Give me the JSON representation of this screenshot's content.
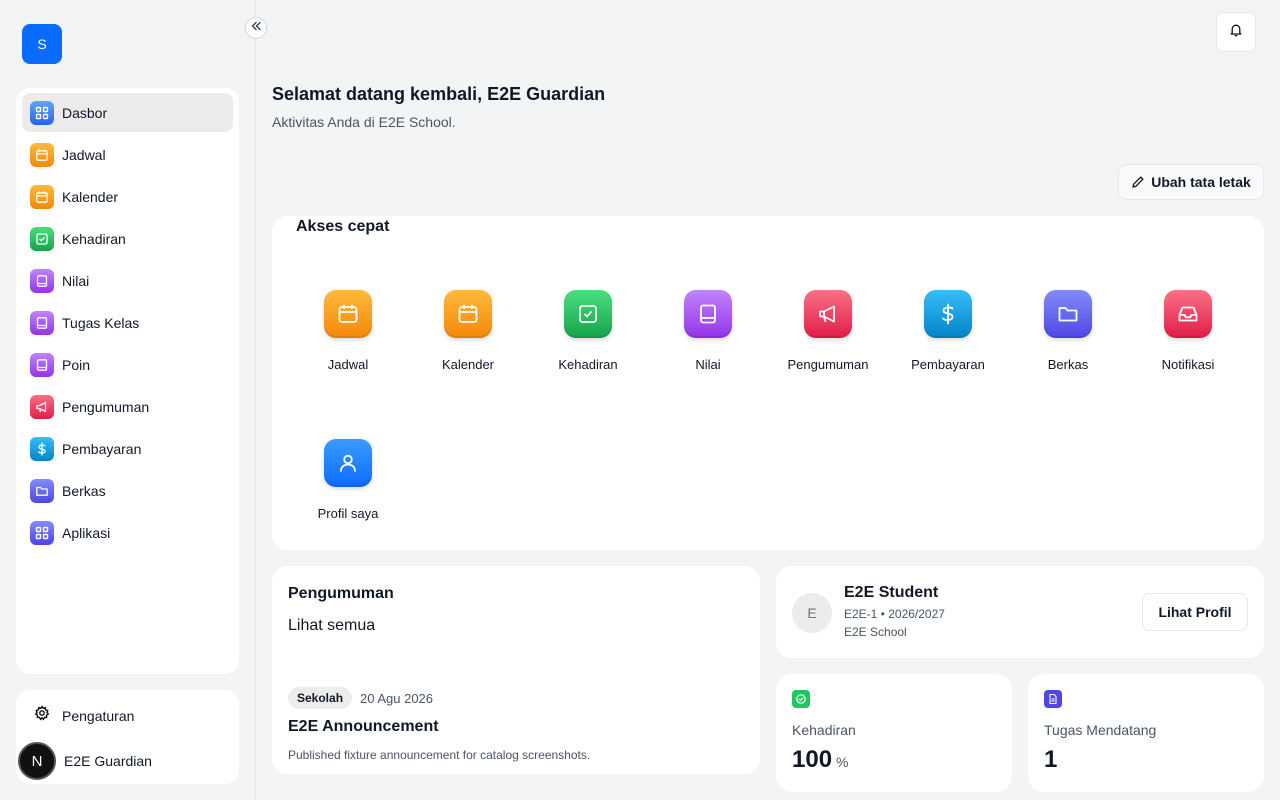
{
  "brand": {
    "logo_letter": "S",
    "accent": "#0a6cff"
  },
  "sidebar": {
    "items": [
      {
        "label": "Dasbor",
        "icon": "grid-icon",
        "active": true
      },
      {
        "label": "Jadwal",
        "icon": "calendar-icon"
      },
      {
        "label": "Kalender",
        "icon": "calendar-icon"
      },
      {
        "label": "Kehadiran",
        "icon": "check-square-icon"
      },
      {
        "label": "Nilai",
        "icon": "book-icon"
      },
      {
        "label": "Tugas Kelas",
        "icon": "book-icon"
      },
      {
        "label": "Poin",
        "icon": "book-icon"
      },
      {
        "label": "Pengumuman",
        "icon": "megaphone-icon"
      },
      {
        "label": "Pembayaran",
        "icon": "dollar-icon"
      },
      {
        "label": "Berkas",
        "icon": "folder-icon"
      },
      {
        "label": "Aplikasi",
        "icon": "grid-icon"
      }
    ],
    "settings_label": "Pengaturan",
    "user_label": "E2E Guardian",
    "user_avatar_letter": "N"
  },
  "header": {
    "title": "Selamat datang kembali, E2E Guardian",
    "subtitle": "Aktivitas Anda di E2E School.",
    "layout_button": "Ubah tata letak"
  },
  "quick_access": {
    "title": "Akses cepat",
    "tiles": [
      {
        "label": "Jadwal",
        "icon": "calendar-icon"
      },
      {
        "label": "Kalender",
        "icon": "calendar-icon"
      },
      {
        "label": "Kehadiran",
        "icon": "check-square-icon"
      },
      {
        "label": "Nilai",
        "icon": "book-icon"
      },
      {
        "label": "Pengumuman",
        "icon": "megaphone-icon"
      },
      {
        "label": "Pembayaran",
        "icon": "dollar-icon"
      },
      {
        "label": "Berkas",
        "icon": "folder-icon"
      },
      {
        "label": "Notifikasi",
        "icon": "inbox-icon"
      },
      {
        "label": "Profil saya",
        "icon": "user-icon"
      }
    ]
  },
  "announcements": {
    "title": "Pengumuman",
    "see_all": "Lihat semua",
    "item": {
      "badge": "Sekolah",
      "date": "20 Agu 2026",
      "title": "E2E Announcement",
      "body": "Published fixture announcement for catalog screenshots."
    }
  },
  "profile": {
    "avatar_letter": "E",
    "name": "E2E Student",
    "class_year": "E2E-1 • 2026/2027",
    "school": "E2E School",
    "button": "Lihat Profil"
  },
  "stats": [
    {
      "label": "Kehadiran",
      "value": "100",
      "unit": "%",
      "icon": "check-circle-icon",
      "color": "#22c55e"
    },
    {
      "label": "Tugas Mendatang",
      "value": "1",
      "unit": "",
      "icon": "document-icon",
      "color": "#4f46e5"
    }
  ]
}
